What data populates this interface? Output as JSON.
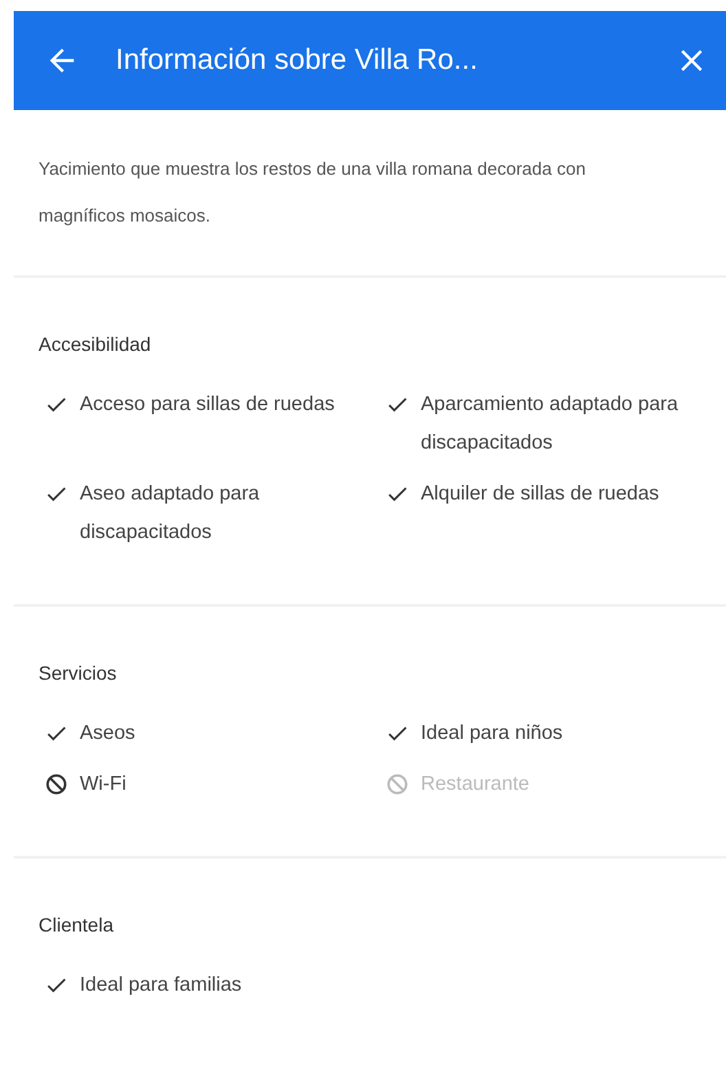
{
  "header": {
    "title": "Información sobre Villa Ro..."
  },
  "description": "Yacimiento que muestra los restos de una villa romana decorada con magníficos mosaicos.",
  "sections": [
    {
      "title": "Accesibilidad",
      "items": [
        {
          "label": "Acceso para sillas de ruedas",
          "kind": "yes",
          "disabled": false
        },
        {
          "label": "Aparcamiento adaptado para discapacitados",
          "kind": "yes",
          "disabled": false
        },
        {
          "label": "Aseo adaptado para discapacitados",
          "kind": "yes",
          "disabled": false
        },
        {
          "label": "Alquiler de sillas de ruedas",
          "kind": "yes",
          "disabled": false
        }
      ]
    },
    {
      "title": "Servicios",
      "items": [
        {
          "label": "Aseos",
          "kind": "yes",
          "disabled": false
        },
        {
          "label": "Ideal para niños",
          "kind": "yes",
          "disabled": false
        },
        {
          "label": "Wi-Fi",
          "kind": "no",
          "disabled": false
        },
        {
          "label": "Restaurante",
          "kind": "no",
          "disabled": true
        }
      ]
    },
    {
      "title": "Clientela",
      "items": [
        {
          "label": "Ideal para familias",
          "kind": "yes",
          "disabled": false
        }
      ]
    }
  ]
}
